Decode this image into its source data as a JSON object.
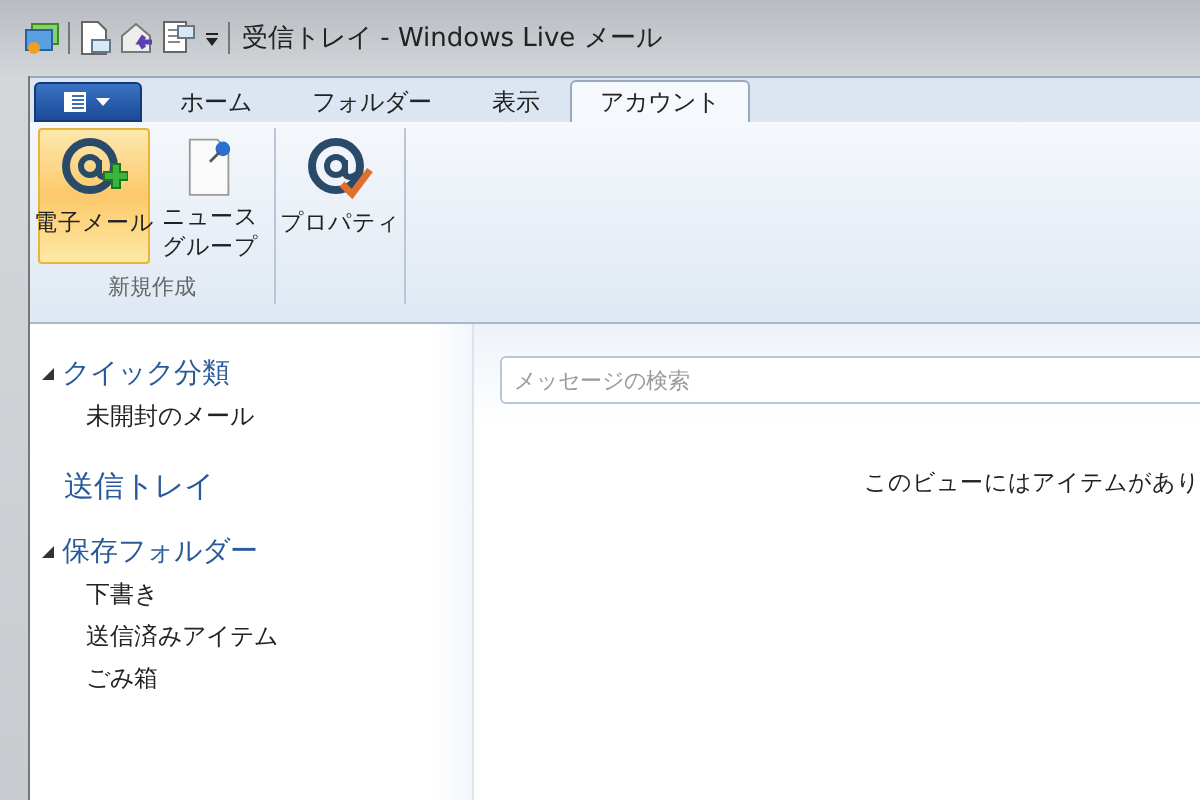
{
  "window": {
    "title": "受信トレイ - Windows Live メール"
  },
  "tabs": [
    {
      "label": "ホーム",
      "selected": false
    },
    {
      "label": "フォルダー",
      "selected": false
    },
    {
      "label": "表示",
      "selected": false
    },
    {
      "label": "アカウント",
      "selected": true
    }
  ],
  "ribbon": {
    "groups": [
      {
        "label": "新規作成",
        "buttons": [
          {
            "label": "電子メール",
            "kind": "email",
            "selected": true
          },
          {
            "label": "ニュースグループ",
            "kind": "news",
            "selected": false
          }
        ]
      },
      {
        "buttons": [
          {
            "label": "プロパティ",
            "kind": "properties",
            "selected": false
          }
        ]
      }
    ]
  },
  "sidebar": {
    "sections": [
      {
        "kind": "group",
        "label": "クイック分類",
        "expanded": true,
        "children": [
          {
            "label": "未開封のメール"
          }
        ]
      },
      {
        "kind": "account",
        "label": "送信トレイ"
      },
      {
        "kind": "group",
        "label": "保存フォルダー",
        "expanded": true,
        "children": [
          {
            "label": "下書き"
          },
          {
            "label": "送信済みアイテム"
          },
          {
            "label": "ごみ箱"
          }
        ]
      }
    ]
  },
  "search": {
    "placeholder": "メッセージの検索"
  },
  "message_list": {
    "empty_text": "このビューにはアイテムがあり"
  }
}
